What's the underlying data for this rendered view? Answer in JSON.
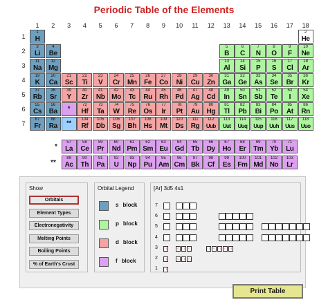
{
  "title": "Periodic Table of the Elements",
  "groups": [
    "1",
    "2",
    "3",
    "4",
    "5",
    "6",
    "7",
    "8",
    "9",
    "10",
    "11",
    "12",
    "13",
    "14",
    "15",
    "16",
    "17",
    "18"
  ],
  "periods": [
    "1",
    "2",
    "3",
    "4",
    "5",
    "6",
    "7"
  ],
  "markers": {
    "lanthanide": "*",
    "actinide": "**"
  },
  "block_colors": {
    "s": "#6e9fbf",
    "p": "#aef5a0",
    "d": "#f5a3a3",
    "f": "#dda0f0",
    "placeholder": "#9bd0ff"
  },
  "elements": [
    {
      "z": "1",
      "sym": "H",
      "period": 1,
      "group": 1,
      "block": "s"
    },
    {
      "z": "2",
      "sym": "He",
      "period": 1,
      "group": 18,
      "block": "s"
    },
    {
      "z": "3",
      "sym": "Li",
      "period": 2,
      "group": 1,
      "block": "s"
    },
    {
      "z": "4",
      "sym": "Be",
      "period": 2,
      "group": 2,
      "block": "s"
    },
    {
      "z": "5",
      "sym": "B",
      "period": 2,
      "group": 13,
      "block": "p"
    },
    {
      "z": "6",
      "sym": "C",
      "period": 2,
      "group": 14,
      "block": "p"
    },
    {
      "z": "7",
      "sym": "N",
      "period": 2,
      "group": 15,
      "block": "p"
    },
    {
      "z": "8",
      "sym": "O",
      "period": 2,
      "group": 16,
      "block": "p"
    },
    {
      "z": "9",
      "sym": "F",
      "period": 2,
      "group": 17,
      "block": "p"
    },
    {
      "z": "10",
      "sym": "Ne",
      "period": 2,
      "group": 18,
      "block": "p"
    },
    {
      "z": "11",
      "sym": "Na",
      "period": 3,
      "group": 1,
      "block": "s"
    },
    {
      "z": "12",
      "sym": "Mg",
      "period": 3,
      "group": 2,
      "block": "s"
    },
    {
      "z": "13",
      "sym": "Al",
      "period": 3,
      "group": 13,
      "block": "p"
    },
    {
      "z": "14",
      "sym": "Si",
      "period": 3,
      "group": 14,
      "block": "p"
    },
    {
      "z": "15",
      "sym": "P",
      "period": 3,
      "group": 15,
      "block": "p"
    },
    {
      "z": "16",
      "sym": "S",
      "period": 3,
      "group": 16,
      "block": "p"
    },
    {
      "z": "17",
      "sym": "Cl",
      "period": 3,
      "group": 17,
      "block": "p"
    },
    {
      "z": "18",
      "sym": "Ar",
      "period": 3,
      "group": 18,
      "block": "p"
    },
    {
      "z": "19",
      "sym": "K",
      "period": 4,
      "group": 1,
      "block": "s"
    },
    {
      "z": "20",
      "sym": "Ca",
      "period": 4,
      "group": 2,
      "block": "s"
    },
    {
      "z": "21",
      "sym": "Sc",
      "period": 4,
      "group": 3,
      "block": "d"
    },
    {
      "z": "22",
      "sym": "Ti",
      "period": 4,
      "group": 4,
      "block": "d"
    },
    {
      "z": "23",
      "sym": "V",
      "period": 4,
      "group": 5,
      "block": "d"
    },
    {
      "z": "24",
      "sym": "Cr",
      "period": 4,
      "group": 6,
      "block": "d"
    },
    {
      "z": "25",
      "sym": "Mn",
      "period": 4,
      "group": 7,
      "block": "d"
    },
    {
      "z": "26",
      "sym": "Fe",
      "period": 4,
      "group": 8,
      "block": "d"
    },
    {
      "z": "27",
      "sym": "Co",
      "period": 4,
      "group": 9,
      "block": "d"
    },
    {
      "z": "28",
      "sym": "Ni",
      "period": 4,
      "group": 10,
      "block": "d"
    },
    {
      "z": "29",
      "sym": "Cu",
      "period": 4,
      "group": 11,
      "block": "d"
    },
    {
      "z": "30",
      "sym": "Zn",
      "period": 4,
      "group": 12,
      "block": "d"
    },
    {
      "z": "31",
      "sym": "Ga",
      "period": 4,
      "group": 13,
      "block": "p"
    },
    {
      "z": "32",
      "sym": "Ge",
      "period": 4,
      "group": 14,
      "block": "p"
    },
    {
      "z": "33",
      "sym": "As",
      "period": 4,
      "group": 15,
      "block": "p"
    },
    {
      "z": "34",
      "sym": "Se",
      "period": 4,
      "group": 16,
      "block": "p"
    },
    {
      "z": "35",
      "sym": "Br",
      "period": 4,
      "group": 17,
      "block": "p"
    },
    {
      "z": "36",
      "sym": "Kr",
      "period": 4,
      "group": 18,
      "block": "p"
    },
    {
      "z": "37",
      "sym": "Rb",
      "period": 5,
      "group": 1,
      "block": "s"
    },
    {
      "z": "38",
      "sym": "Sr",
      "period": 5,
      "group": 2,
      "block": "s"
    },
    {
      "z": "39",
      "sym": "Y",
      "period": 5,
      "group": 3,
      "block": "d"
    },
    {
      "z": "40",
      "sym": "Zr",
      "period": 5,
      "group": 4,
      "block": "d"
    },
    {
      "z": "41",
      "sym": "Nb",
      "period": 5,
      "group": 5,
      "block": "d"
    },
    {
      "z": "42",
      "sym": "Mo",
      "period": 5,
      "group": 6,
      "block": "d"
    },
    {
      "z": "43",
      "sym": "Tc",
      "period": 5,
      "group": 7,
      "block": "d"
    },
    {
      "z": "44",
      "sym": "Ru",
      "period": 5,
      "group": 8,
      "block": "d"
    },
    {
      "z": "45",
      "sym": "Rh",
      "period": 5,
      "group": 9,
      "block": "d"
    },
    {
      "z": "46",
      "sym": "Pd",
      "period": 5,
      "group": 10,
      "block": "d"
    },
    {
      "z": "47",
      "sym": "Ag",
      "period": 5,
      "group": 11,
      "block": "d"
    },
    {
      "z": "48",
      "sym": "Cd",
      "period": 5,
      "group": 12,
      "block": "d"
    },
    {
      "z": "49",
      "sym": "In",
      "period": 5,
      "group": 13,
      "block": "p"
    },
    {
      "z": "50",
      "sym": "Sn",
      "period": 5,
      "group": 14,
      "block": "p"
    },
    {
      "z": "51",
      "sym": "Sb",
      "period": 5,
      "group": 15,
      "block": "p"
    },
    {
      "z": "52",
      "sym": "Te",
      "period": 5,
      "group": 16,
      "block": "p"
    },
    {
      "z": "53",
      "sym": "I",
      "period": 5,
      "group": 17,
      "block": "p"
    },
    {
      "z": "54",
      "sym": "Xe",
      "period": 5,
      "group": 18,
      "block": "p"
    },
    {
      "z": "55",
      "sym": "Cs",
      "period": 6,
      "group": 1,
      "block": "s"
    },
    {
      "z": "56",
      "sym": "Ba",
      "period": 6,
      "group": 2,
      "block": "s"
    },
    {
      "z": "*",
      "sym": "",
      "period": 6,
      "group": 3,
      "block": "f"
    },
    {
      "z": "72",
      "sym": "Hf",
      "period": 6,
      "group": 4,
      "block": "d"
    },
    {
      "z": "73",
      "sym": "Ta",
      "period": 6,
      "group": 5,
      "block": "d"
    },
    {
      "z": "74",
      "sym": "W",
      "period": 6,
      "group": 6,
      "block": "d"
    },
    {
      "z": "75",
      "sym": "Re",
      "period": 6,
      "group": 7,
      "block": "d"
    },
    {
      "z": "76",
      "sym": "Os",
      "period": 6,
      "group": 8,
      "block": "d"
    },
    {
      "z": "77",
      "sym": "Ir",
      "period": 6,
      "group": 9,
      "block": "d"
    },
    {
      "z": "78",
      "sym": "Pt",
      "period": 6,
      "group": 10,
      "block": "d"
    },
    {
      "z": "79",
      "sym": "Au",
      "period": 6,
      "group": 11,
      "block": "d"
    },
    {
      "z": "80",
      "sym": "Hg",
      "period": 6,
      "group": 12,
      "block": "d"
    },
    {
      "z": "81",
      "sym": "Tl",
      "period": 6,
      "group": 13,
      "block": "p"
    },
    {
      "z": "82",
      "sym": "Pb",
      "period": 6,
      "group": 14,
      "block": "p"
    },
    {
      "z": "83",
      "sym": "Bi",
      "period": 6,
      "group": 15,
      "block": "p"
    },
    {
      "z": "84",
      "sym": "Po",
      "period": 6,
      "group": 16,
      "block": "p"
    },
    {
      "z": "85",
      "sym": "At",
      "period": 6,
      "group": 17,
      "block": "p"
    },
    {
      "z": "86",
      "sym": "Rn",
      "period": 6,
      "group": 18,
      "block": "p"
    },
    {
      "z": "87",
      "sym": "Fr",
      "period": 7,
      "group": 1,
      "block": "s"
    },
    {
      "z": "88",
      "sym": "Ra",
      "period": 7,
      "group": 2,
      "block": "s"
    },
    {
      "z": "**",
      "sym": "",
      "period": 7,
      "group": 3,
      "block": "placeholder"
    },
    {
      "z": "104",
      "sym": "Rf",
      "period": 7,
      "group": 4,
      "block": "d"
    },
    {
      "z": "105",
      "sym": "Db",
      "period": 7,
      "group": 5,
      "block": "d"
    },
    {
      "z": "106",
      "sym": "Sg",
      "period": 7,
      "group": 6,
      "block": "d"
    },
    {
      "z": "107",
      "sym": "Bh",
      "period": 7,
      "group": 7,
      "block": "d"
    },
    {
      "z": "108",
      "sym": "Hs",
      "period": 7,
      "group": 8,
      "block": "d"
    },
    {
      "z": "109",
      "sym": "Mt",
      "period": 7,
      "group": 9,
      "block": "d"
    },
    {
      "z": "110",
      "sym": "Ds",
      "period": 7,
      "group": 10,
      "block": "d"
    },
    {
      "z": "111",
      "sym": "Rg",
      "period": 7,
      "group": 11,
      "block": "d"
    },
    {
      "z": "112",
      "sym": "Uub",
      "period": 7,
      "group": 12,
      "block": "d"
    },
    {
      "z": "113",
      "sym": "Uut",
      "period": 7,
      "group": 13,
      "block": "p"
    },
    {
      "z": "114",
      "sym": "Uuq",
      "period": 7,
      "group": 14,
      "block": "p"
    },
    {
      "z": "115",
      "sym": "Uup",
      "period": 7,
      "group": 15,
      "block": "p"
    },
    {
      "z": "116",
      "sym": "Uuh",
      "period": 7,
      "group": 16,
      "block": "p"
    },
    {
      "z": "117",
      "sym": "Uus",
      "period": 7,
      "group": 17,
      "block": "p"
    },
    {
      "z": "118",
      "sym": "Uuo",
      "period": 7,
      "group": 18,
      "block": "p"
    }
  ],
  "lanthanides": [
    {
      "z": "57",
      "sym": "La"
    },
    {
      "z": "58",
      "sym": "Ce"
    },
    {
      "z": "59",
      "sym": "Pr"
    },
    {
      "z": "60",
      "sym": "Nd"
    },
    {
      "z": "61",
      "sym": "Pm"
    },
    {
      "z": "62",
      "sym": "Sm"
    },
    {
      "z": "63",
      "sym": "Eu"
    },
    {
      "z": "64",
      "sym": "Gd"
    },
    {
      "z": "65",
      "sym": "Tb"
    },
    {
      "z": "66",
      "sym": "Dy"
    },
    {
      "z": "67",
      "sym": "Ho"
    },
    {
      "z": "68",
      "sym": "Er"
    },
    {
      "z": "69",
      "sym": "Tm"
    },
    {
      "z": "70",
      "sym": "Yb"
    },
    {
      "z": "71",
      "sym": "Lu"
    }
  ],
  "actinides": [
    {
      "z": "89",
      "sym": "Ac"
    },
    {
      "z": "90",
      "sym": "Th"
    },
    {
      "z": "91",
      "sym": "Pa"
    },
    {
      "z": "92",
      "sym": "U"
    },
    {
      "z": "93",
      "sym": "Np"
    },
    {
      "z": "94",
      "sym": "Pu"
    },
    {
      "z": "95",
      "sym": "Am"
    },
    {
      "z": "96",
      "sym": "Cm"
    },
    {
      "z": "97",
      "sym": "Bk"
    },
    {
      "z": "98",
      "sym": "Cf"
    },
    {
      "z": "99",
      "sym": "Es"
    },
    {
      "z": "100",
      "sym": "Fm"
    },
    {
      "z": "101",
      "sym": "Md"
    },
    {
      "z": "102",
      "sym": "No"
    },
    {
      "z": "103",
      "sym": "Lr"
    }
  ],
  "show_panel": {
    "heading": "Show",
    "buttons": [
      "Orbitals",
      "Element Types",
      "Electronegativity",
      "Melting Points",
      "Boiling Points",
      "% of Earth's Crust"
    ],
    "active": "Orbitals"
  },
  "legend_panel": {
    "heading": "Orbital Legend",
    "items": [
      {
        "letter": "s",
        "label": "block",
        "block": "s"
      },
      {
        "letter": "p",
        "label": "block",
        "block": "p"
      },
      {
        "letter": "d",
        "label": "block",
        "block": "d"
      },
      {
        "letter": "f",
        "label": "block",
        "block": "f"
      }
    ]
  },
  "config_panel": {
    "heading": "[Ar] 3d5 4s1",
    "shells": [
      {
        "n": "7",
        "groups": [
          1,
          3
        ]
      },
      {
        "n": "6",
        "groups": [
          1,
          3,
          5
        ]
      },
      {
        "n": "5",
        "groups": [
          1,
          3,
          5,
          7
        ]
      },
      {
        "n": "4",
        "groups": [
          1,
          3,
          5,
          7
        ]
      },
      {
        "n": "3",
        "groups": [
          2,
          6,
          5
        ]
      },
      {
        "n": "2",
        "groups": [
          2,
          6
        ]
      },
      {
        "n": "1",
        "groups": [
          2
        ]
      }
    ],
    "filled_arrow": "↑⇂"
  },
  "print_button": "Print Table"
}
